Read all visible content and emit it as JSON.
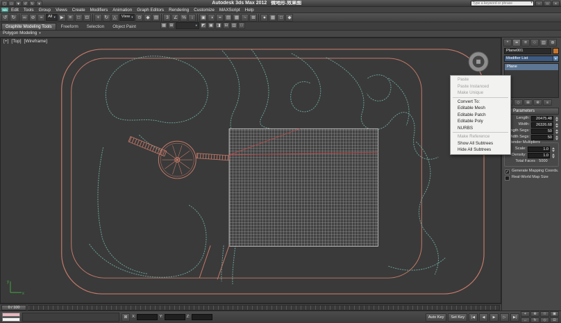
{
  "window": {
    "app_button": "3ds",
    "app_title": "Autodesk 3ds Max 2012",
    "doc_title": "微地形.效果图",
    "search_placeholder": "Type a keyword or phrase",
    "search_glyph": "▾"
  },
  "titlebar": {
    "qat": [
      {
        "name": "new-file-icon",
        "glyph": "▢"
      },
      {
        "name": "open-file-icon",
        "glyph": "▭"
      },
      {
        "name": "save-file-icon",
        "glyph": "▼"
      },
      {
        "name": "undo-icon",
        "glyph": "↺"
      },
      {
        "name": "redo-icon",
        "glyph": "↻"
      },
      {
        "name": "workspace-dropdown-icon",
        "glyph": "▾"
      }
    ],
    "window_buttons": [
      {
        "name": "minimize-button",
        "glyph": "−"
      },
      {
        "name": "maximize-button",
        "glyph": "□"
      },
      {
        "name": "close-button",
        "glyph": "×"
      }
    ]
  },
  "menubar": {
    "items": [
      "Edit",
      "Tools",
      "Group",
      "Views",
      "Create",
      "Modifiers",
      "Animation",
      "Graph Editors",
      "Rendering",
      "Customize",
      "MAXScript",
      "Help"
    ]
  },
  "toolbar": {
    "filter_dropdown": "All",
    "coord_dropdown": "View",
    "dd_arrow": "▾",
    "icons": [
      {
        "name": "undo-icon",
        "glyph": "↺"
      },
      {
        "name": "redo-icon",
        "glyph": "↻"
      },
      {
        "name": "select-and-link-icon",
        "glyph": "∞"
      },
      {
        "name": "unlink-selection-icon",
        "glyph": "⊘"
      },
      {
        "name": "bind-to-space-warp-icon",
        "glyph": "≈"
      },
      {
        "name": "select-object-icon",
        "glyph": "▶"
      },
      {
        "name": "select-by-name-icon",
        "glyph": "≡"
      },
      {
        "name": "rectangular-selection-region-icon",
        "glyph": "□"
      },
      {
        "name": "window-crossing-icon",
        "glyph": "⊡"
      },
      {
        "name": "select-and-move-icon",
        "glyph": "+"
      },
      {
        "name": "select-and-rotate-icon",
        "glyph": "↻"
      },
      {
        "name": "select-and-scale-icon",
        "glyph": "△"
      },
      {
        "name": "use-pivot-center-icon",
        "glyph": "⊙"
      },
      {
        "name": "select-and-manipulate-icon",
        "glyph": "◆"
      },
      {
        "name": "keyboard-override-icon",
        "glyph": "▤"
      },
      {
        "name": "snaps-toggle-icon",
        "glyph": "3"
      },
      {
        "name": "angle-snap-icon",
        "glyph": "∠"
      },
      {
        "name": "percent-snap-icon",
        "glyph": "%"
      },
      {
        "name": "spinner-snap-icon",
        "glyph": "↕"
      },
      {
        "name": "named-selection-sets-icon",
        "glyph": "▣"
      },
      {
        "name": "mirror-icon",
        "glyph": "◑"
      },
      {
        "name": "align-icon",
        "glyph": "="
      },
      {
        "name": "layer-manager-icon",
        "glyph": "▤"
      },
      {
        "name": "graphite-ribbon-toggle-icon",
        "glyph": "▦"
      },
      {
        "name": "curve-editor-icon",
        "glyph": "~"
      },
      {
        "name": "schematic-view-icon",
        "glyph": "⊞"
      },
      {
        "name": "material-editor-icon",
        "glyph": "●"
      },
      {
        "name": "render-setup-icon",
        "glyph": "▦"
      },
      {
        "name": "rendered-frame-window-icon",
        "glyph": "□"
      },
      {
        "name": "render-production-icon",
        "glyph": "◆"
      }
    ]
  },
  "ribbon": {
    "tabs": [
      "Graphite Modeling Tools",
      "Freeform",
      "Selection",
      "Object Paint"
    ],
    "tools": [
      "▦",
      "⊞",
      "◩",
      "▣",
      "◨",
      "⊟",
      "▥",
      "□"
    ],
    "dd_arrow": "▾"
  },
  "modeling_strip": {
    "label": "Polygon Modeling",
    "chevron": "▾"
  },
  "viewport": {
    "label_plus": "[+]",
    "label_view": "[Top]",
    "label_shading": "[Wireframe]"
  },
  "context_menu": {
    "items": [
      "Paste",
      "Paste Instanced",
      "Make Unique",
      "Convert To:",
      "Editable Mesh",
      "Editable Patch",
      "Editable Poly",
      "NURBS",
      "Make Reference",
      "Show All Subtrees",
      "Hide All Subtrees"
    ]
  },
  "command_panel": {
    "tabs": [
      {
        "name": "create-tab-icon",
        "glyph": "*"
      },
      {
        "name": "modify-tab-icon",
        "glyph": "≈"
      },
      {
        "name": "hierarchy-tab-icon",
        "glyph": "≡"
      },
      {
        "name": "motion-tab-icon",
        "glyph": "○"
      },
      {
        "name": "display-tab-icon",
        "glyph": "▥"
      },
      {
        "name": "utilities-tab-icon",
        "glyph": "⊕"
      }
    ],
    "object_name": "Plane001",
    "modifier_list_label": "Modifier List",
    "dd_arrow": "▼",
    "stack_items": [
      "Plane"
    ],
    "stack_tools": [
      {
        "name": "pin-stack-icon",
        "glyph": "•"
      },
      {
        "name": "show-end-result-icon",
        "glyph": "◇"
      },
      {
        "name": "make-unique-icon",
        "glyph": "⊞"
      },
      {
        "name": "remove-modifier-icon",
        "glyph": "⊗"
      },
      {
        "name": "configure-modifier-sets-icon",
        "glyph": "≡"
      }
    ],
    "rollout_title": "Parameters",
    "rollout_minus": "−",
    "params": {
      "length_label": "Length:",
      "length_value": "20475.48",
      "width_label": "Width:",
      "width_value": "26326.68",
      "length_segs_label": "Length Segs:",
      "length_segs_value": "50",
      "width_segs_label": "Width Segs:",
      "width_segs_value": "50"
    },
    "render_multipliers": {
      "title": "Render Multipliers",
      "scale_label": "Scale:",
      "scale_value": "1.0",
      "density_label": "Density:",
      "density_value": "1.0",
      "total_faces_label": "Total Faces :",
      "total_faces_value": "5000"
    },
    "check_glyph": "✓",
    "checkboxes": [
      {
        "label": "Generate Mapping Coords.",
        "checked": true
      },
      {
        "label": "Real-World Map Size",
        "checked": false
      }
    ]
  },
  "timeline": {
    "slider_label": "0 / 100"
  },
  "statusbar": {
    "lock_glyph": "⊠",
    "x_label": "X:",
    "y_label": "Y:",
    "z_label": "Z:",
    "auto_key_label": "Auto Key",
    "set_key_label": "Set Key",
    "playback": [
      {
        "name": "go-to-start-button",
        "glyph": "|◀"
      },
      {
        "name": "previous-frame-button",
        "glyph": "◀"
      },
      {
        "name": "play-button",
        "glyph": "▶"
      },
      {
        "name": "next-frame-button",
        "glyph": "▷"
      },
      {
        "name": "go-to-end-button",
        "glyph": "▶|"
      }
    ],
    "nav": [
      {
        "name": "zoom-icon",
        "glyph": "+"
      },
      {
        "name": "zoom-all-icon",
        "glyph": "⊕"
      },
      {
        "name": "zoom-extents-icon",
        "glyph": "□"
      },
      {
        "name": "zoom-region-icon",
        "glyph": "▣"
      },
      {
        "name": "pan-icon",
        "glyph": "↔"
      },
      {
        "name": "orbit-icon",
        "glyph": "↻"
      },
      {
        "name": "field-of-view-icon",
        "glyph": "◇"
      },
      {
        "name": "maximize-viewport-toggle-icon",
        "glyph": "⊡"
      }
    ]
  }
}
